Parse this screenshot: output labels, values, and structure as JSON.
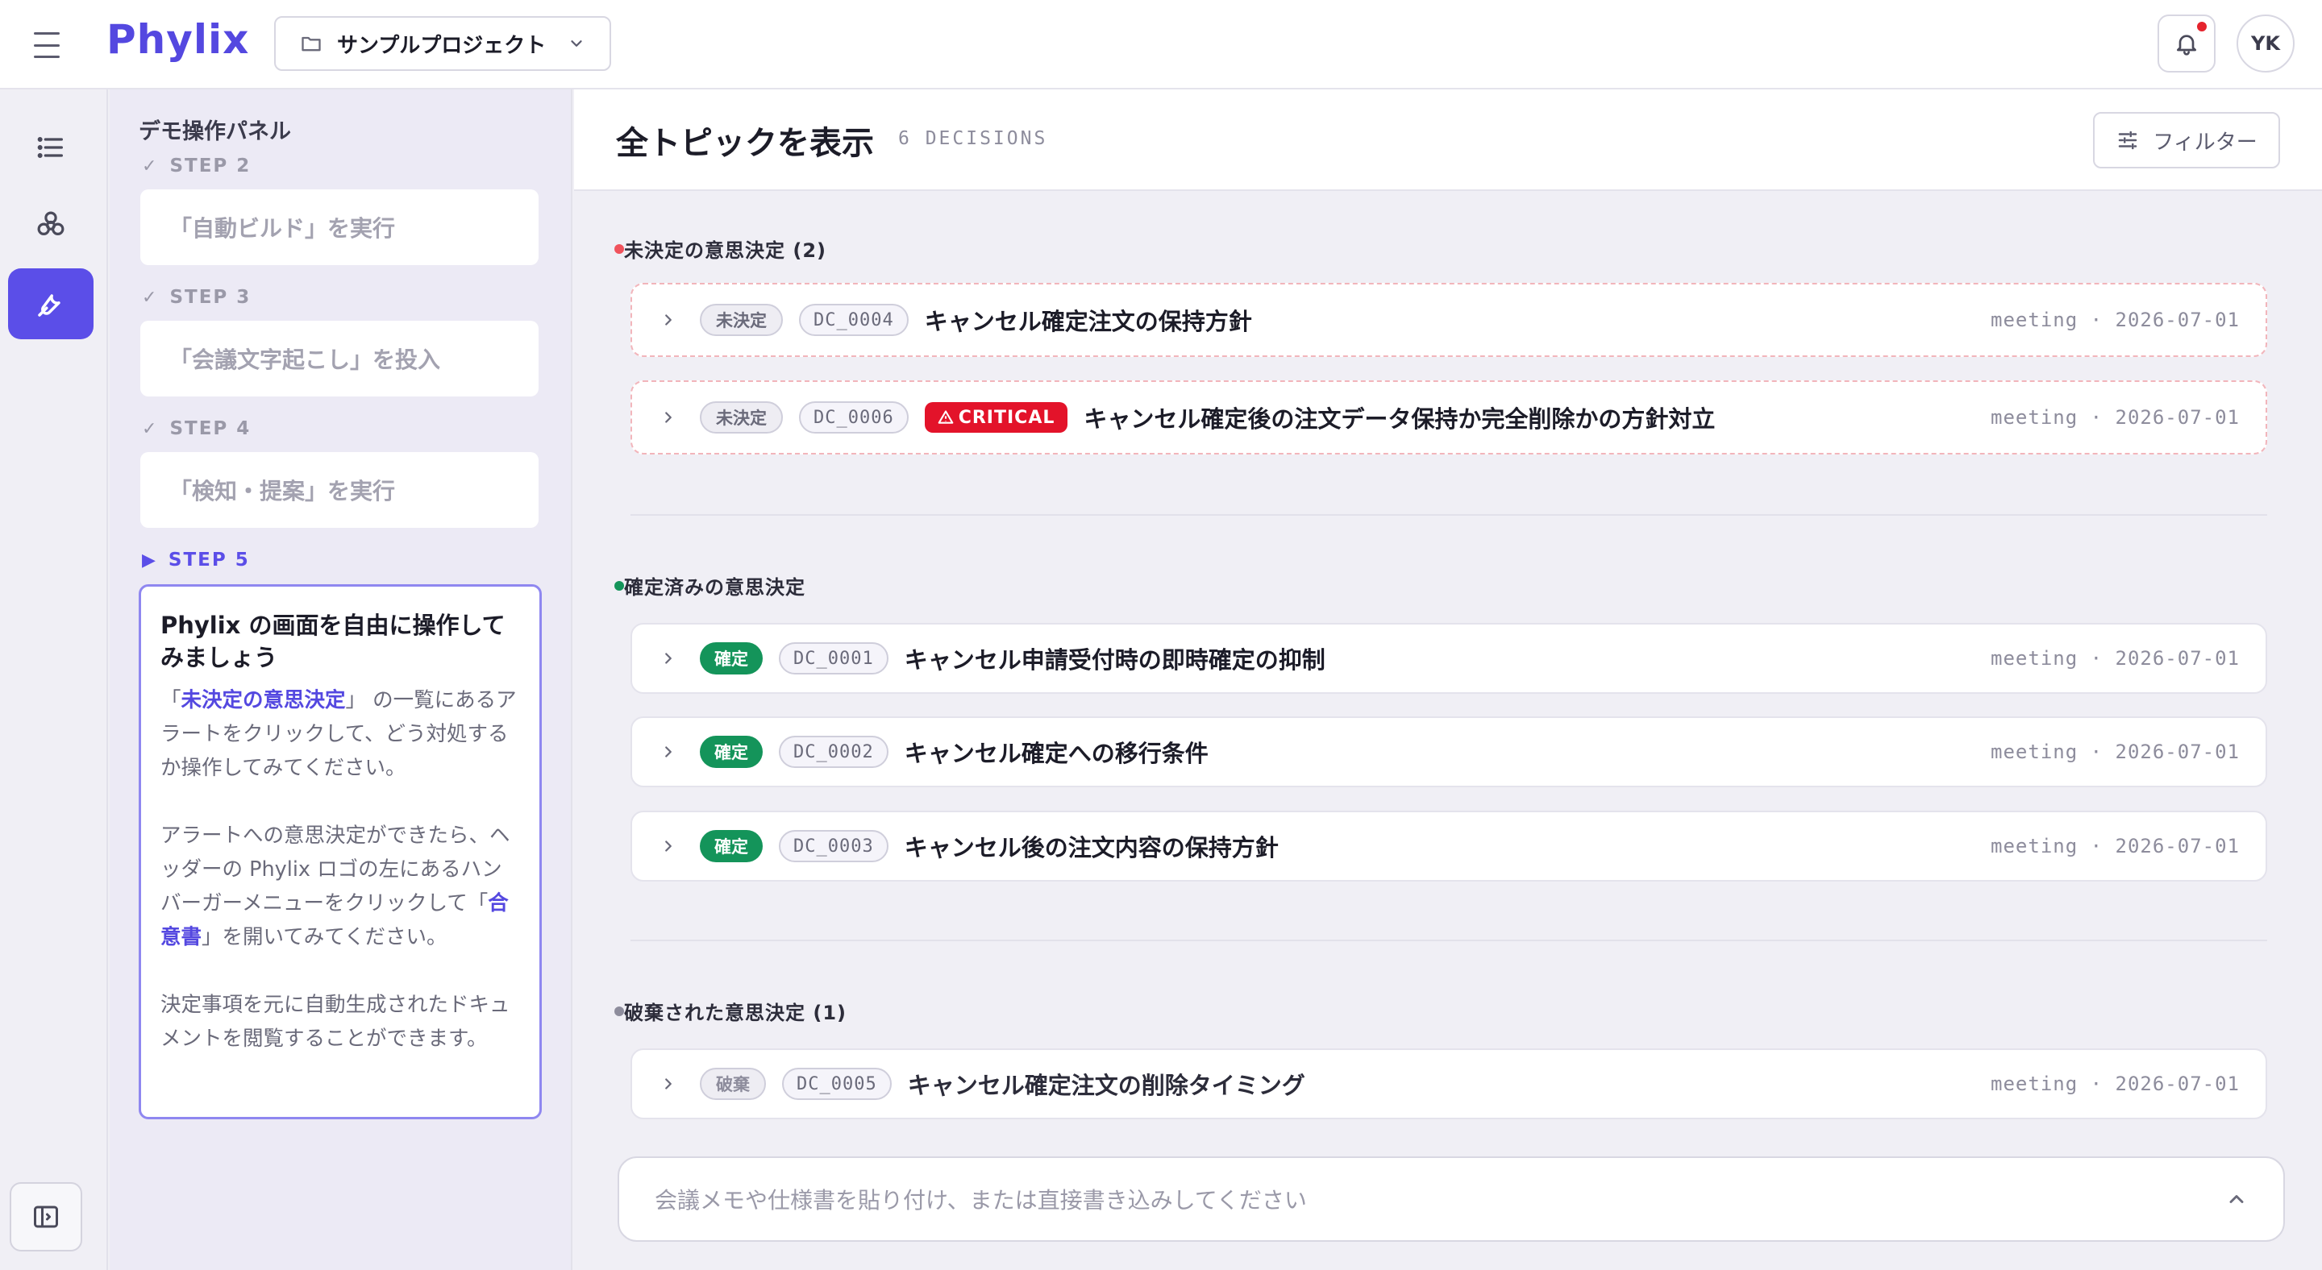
{
  "app": {
    "logo": "Phylix",
    "project": "サンプルプロジェクト",
    "user_initials": "YK"
  },
  "demo_panel": {
    "title": "デモ操作パネル",
    "steps": [
      {
        "label": "STEP 2",
        "status": "done",
        "text": "「自動ビルド」を実行"
      },
      {
        "label": "STEP 3",
        "status": "done",
        "text": "「会議文字起こし」を投入"
      },
      {
        "label": "STEP 4",
        "status": "done",
        "text": "「検知・提案」を実行"
      }
    ],
    "current": {
      "label": "STEP 5",
      "heading": "Phylix の画面を自由に操作してみましょう",
      "p1_pre": "「",
      "p1_link": "未決定の意思決定",
      "p1_post": "」 の一覧にあるアラートをクリックして、どう対処するか操作してみてください。",
      "p2_pre": "アラートへの意思決定ができたら、ヘッダーの Phylix ロゴの左にあるハンバーガーメニューをクリックして「",
      "p2_link": "合意書",
      "p2_post": "」を開いてみてください。",
      "p3": "決定事項を元に自動生成されたドキュメントを閲覧することができます。"
    }
  },
  "main": {
    "title": "全トピックを表示",
    "count": "6 DECISIONS",
    "filter_label": "フィルター",
    "sections": {
      "pending": {
        "title": "未決定の意思決定 (2)",
        "color": "#f0525c",
        "rows": [
          {
            "status": "未決定",
            "id": "DC_0004",
            "critical": "",
            "title": "キャンセル確定注文の保持方針",
            "meta": "meeting · 2026-07-01"
          },
          {
            "status": "未決定",
            "id": "DC_0006",
            "critical": "CRITICAL",
            "title": "キャンセル確定後の注文データ保持か完全削除かの方針対立",
            "meta": "meeting · 2026-07-01"
          }
        ]
      },
      "confirmed": {
        "title": "確定済みの意思決定",
        "color": "#14945a",
        "rows": [
          {
            "status": "確定",
            "id": "DC_0001",
            "title": "キャンセル申請受付時の即時確定の抑制",
            "meta": "meeting · 2026-07-01"
          },
          {
            "status": "確定",
            "id": "DC_0002",
            "title": "キャンセル確定への移行条件",
            "meta": "meeting · 2026-07-01"
          },
          {
            "status": "確定",
            "id": "DC_0003",
            "title": "キャンセル後の注文内容の保持方針",
            "meta": "meeting · 2026-07-01"
          }
        ]
      },
      "discarded": {
        "title": "破棄された意思決定 (1)",
        "color": "#8d8c9c",
        "rows": [
          {
            "status": "破棄",
            "id": "DC_0005",
            "title": "キャンセル確定注文の削除タイミング",
            "meta": "meeting · 2026-07-01"
          }
        ]
      }
    },
    "composer_placeholder": "会議メモや仕様書を貼り付け、または直接書き込みしてください"
  },
  "icons": {
    "menu": "hamburger-icon",
    "folder": "folder-icon",
    "bell": "bell-icon",
    "list": "list-icon",
    "graph": "graph-icon",
    "tools": "wrench-icon",
    "panel": "sidebar-toggle-icon",
    "filter": "sliders-icon"
  }
}
